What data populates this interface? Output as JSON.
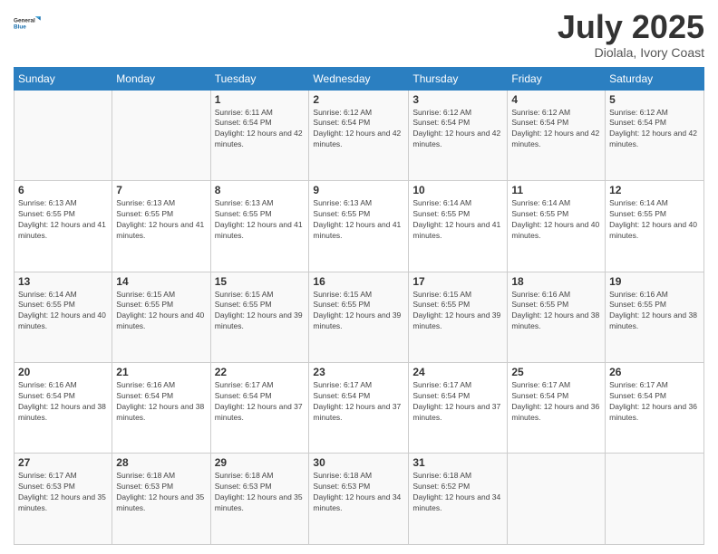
{
  "logo": {
    "line1": "General",
    "line2": "Blue"
  },
  "header": {
    "month": "July 2025",
    "location": "Diolala, Ivory Coast"
  },
  "weekdays": [
    "Sunday",
    "Monday",
    "Tuesday",
    "Wednesday",
    "Thursday",
    "Friday",
    "Saturday"
  ],
  "weeks": [
    [
      {
        "day": "",
        "info": ""
      },
      {
        "day": "",
        "info": ""
      },
      {
        "day": "1",
        "info": "Sunrise: 6:11 AM\nSunset: 6:54 PM\nDaylight: 12 hours and 42 minutes."
      },
      {
        "day": "2",
        "info": "Sunrise: 6:12 AM\nSunset: 6:54 PM\nDaylight: 12 hours and 42 minutes."
      },
      {
        "day": "3",
        "info": "Sunrise: 6:12 AM\nSunset: 6:54 PM\nDaylight: 12 hours and 42 minutes."
      },
      {
        "day": "4",
        "info": "Sunrise: 6:12 AM\nSunset: 6:54 PM\nDaylight: 12 hours and 42 minutes."
      },
      {
        "day": "5",
        "info": "Sunrise: 6:12 AM\nSunset: 6:54 PM\nDaylight: 12 hours and 42 minutes."
      }
    ],
    [
      {
        "day": "6",
        "info": "Sunrise: 6:13 AM\nSunset: 6:55 PM\nDaylight: 12 hours and 41 minutes."
      },
      {
        "day": "7",
        "info": "Sunrise: 6:13 AM\nSunset: 6:55 PM\nDaylight: 12 hours and 41 minutes."
      },
      {
        "day": "8",
        "info": "Sunrise: 6:13 AM\nSunset: 6:55 PM\nDaylight: 12 hours and 41 minutes."
      },
      {
        "day": "9",
        "info": "Sunrise: 6:13 AM\nSunset: 6:55 PM\nDaylight: 12 hours and 41 minutes."
      },
      {
        "day": "10",
        "info": "Sunrise: 6:14 AM\nSunset: 6:55 PM\nDaylight: 12 hours and 41 minutes."
      },
      {
        "day": "11",
        "info": "Sunrise: 6:14 AM\nSunset: 6:55 PM\nDaylight: 12 hours and 40 minutes."
      },
      {
        "day": "12",
        "info": "Sunrise: 6:14 AM\nSunset: 6:55 PM\nDaylight: 12 hours and 40 minutes."
      }
    ],
    [
      {
        "day": "13",
        "info": "Sunrise: 6:14 AM\nSunset: 6:55 PM\nDaylight: 12 hours and 40 minutes."
      },
      {
        "day": "14",
        "info": "Sunrise: 6:15 AM\nSunset: 6:55 PM\nDaylight: 12 hours and 40 minutes."
      },
      {
        "day": "15",
        "info": "Sunrise: 6:15 AM\nSunset: 6:55 PM\nDaylight: 12 hours and 39 minutes."
      },
      {
        "day": "16",
        "info": "Sunrise: 6:15 AM\nSunset: 6:55 PM\nDaylight: 12 hours and 39 minutes."
      },
      {
        "day": "17",
        "info": "Sunrise: 6:15 AM\nSunset: 6:55 PM\nDaylight: 12 hours and 39 minutes."
      },
      {
        "day": "18",
        "info": "Sunrise: 6:16 AM\nSunset: 6:55 PM\nDaylight: 12 hours and 38 minutes."
      },
      {
        "day": "19",
        "info": "Sunrise: 6:16 AM\nSunset: 6:55 PM\nDaylight: 12 hours and 38 minutes."
      }
    ],
    [
      {
        "day": "20",
        "info": "Sunrise: 6:16 AM\nSunset: 6:54 PM\nDaylight: 12 hours and 38 minutes."
      },
      {
        "day": "21",
        "info": "Sunrise: 6:16 AM\nSunset: 6:54 PM\nDaylight: 12 hours and 38 minutes."
      },
      {
        "day": "22",
        "info": "Sunrise: 6:17 AM\nSunset: 6:54 PM\nDaylight: 12 hours and 37 minutes."
      },
      {
        "day": "23",
        "info": "Sunrise: 6:17 AM\nSunset: 6:54 PM\nDaylight: 12 hours and 37 minutes."
      },
      {
        "day": "24",
        "info": "Sunrise: 6:17 AM\nSunset: 6:54 PM\nDaylight: 12 hours and 37 minutes."
      },
      {
        "day": "25",
        "info": "Sunrise: 6:17 AM\nSunset: 6:54 PM\nDaylight: 12 hours and 36 minutes."
      },
      {
        "day": "26",
        "info": "Sunrise: 6:17 AM\nSunset: 6:54 PM\nDaylight: 12 hours and 36 minutes."
      }
    ],
    [
      {
        "day": "27",
        "info": "Sunrise: 6:17 AM\nSunset: 6:53 PM\nDaylight: 12 hours and 35 minutes."
      },
      {
        "day": "28",
        "info": "Sunrise: 6:18 AM\nSunset: 6:53 PM\nDaylight: 12 hours and 35 minutes."
      },
      {
        "day": "29",
        "info": "Sunrise: 6:18 AM\nSunset: 6:53 PM\nDaylight: 12 hours and 35 minutes."
      },
      {
        "day": "30",
        "info": "Sunrise: 6:18 AM\nSunset: 6:53 PM\nDaylight: 12 hours and 34 minutes."
      },
      {
        "day": "31",
        "info": "Sunrise: 6:18 AM\nSunset: 6:52 PM\nDaylight: 12 hours and 34 minutes."
      },
      {
        "day": "",
        "info": ""
      },
      {
        "day": "",
        "info": ""
      }
    ]
  ]
}
